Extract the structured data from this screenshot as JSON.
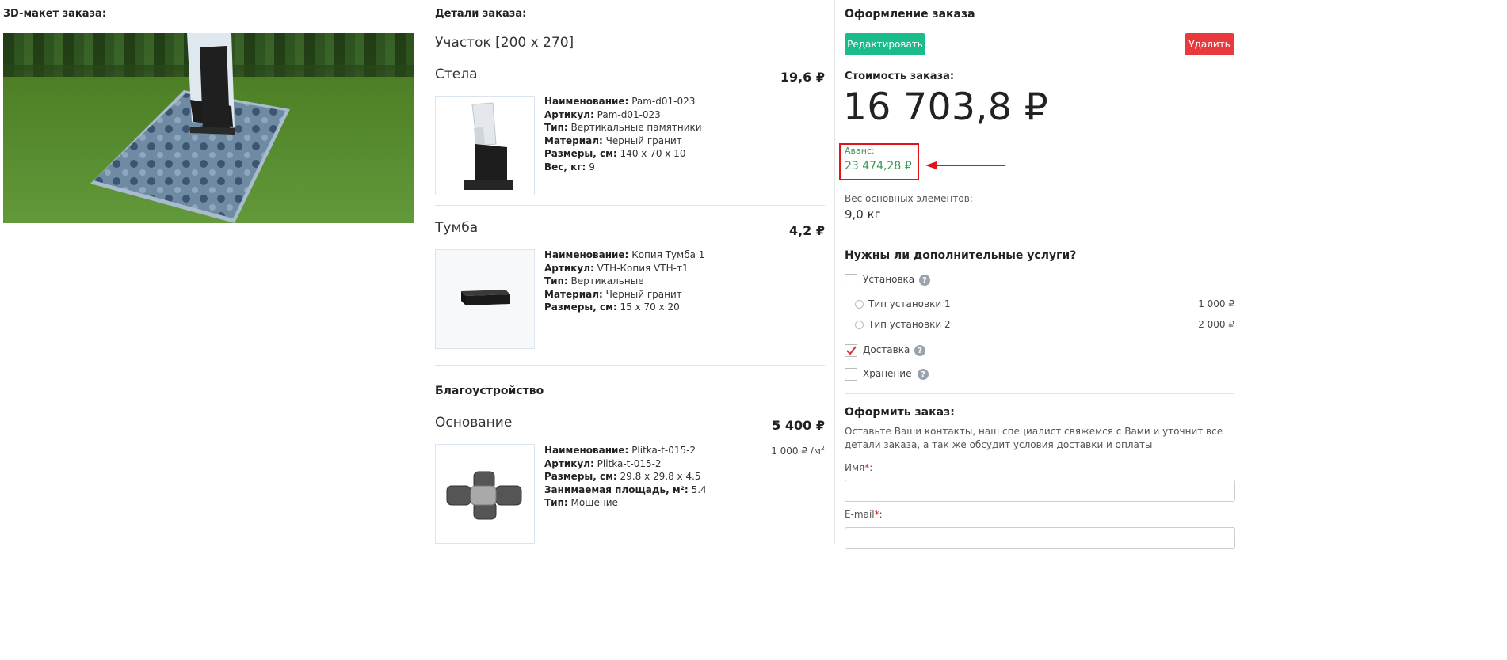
{
  "left": {
    "title": "3D-макет заказа:"
  },
  "middle": {
    "title": "Детали заказа:",
    "plot": "Участок [200 x 270]",
    "items": [
      {
        "name": "Стела",
        "price": "19,6 ₽",
        "specs": [
          {
            "k": "Наименование:",
            "v": "Pam-d01-023"
          },
          {
            "k": "Артикул:",
            "v": "Pam-d01-023"
          },
          {
            "k": "Тип:",
            "v": "Вертикальные памятники"
          },
          {
            "k": "Материал:",
            "v": "Черный гранит"
          },
          {
            "k": "Размеры, см:",
            "v": "140 x 70 x 10"
          },
          {
            "k": "Вес, кг:",
            "v": "9"
          }
        ]
      },
      {
        "name": "Тумба",
        "price": "4,2 ₽",
        "specs": [
          {
            "k": "Наименование:",
            "v": "Копия Тумба 1"
          },
          {
            "k": "Артикул:",
            "v": "VTH-Копия VTH-т1"
          },
          {
            "k": "Тип:",
            "v": "Вертикальные"
          },
          {
            "k": "Материал:",
            "v": "Черный гранит"
          },
          {
            "k": "Размеры, см:",
            "v": "15 x 70 x 20"
          }
        ]
      }
    ],
    "landscaping": {
      "title": "Благоустройство",
      "item": {
        "name": "Основание",
        "price": "5 400 ₽",
        "unit_price": "1 000 ₽ /м",
        "unit_sup": "2",
        "specs": [
          {
            "k": "Наименование:",
            "v": "Plitka-t-015-2"
          },
          {
            "k": "Артикул:",
            "v": "Plitka-t-015-2"
          },
          {
            "k": "Размеры, см:",
            "v": "29.8 x 29.8 x 4.5"
          },
          {
            "k": "Занимаемая площадь, м²:",
            "v": "5.4"
          },
          {
            "k": "Тип:",
            "v": "Мощение"
          }
        ]
      }
    }
  },
  "right": {
    "title": "Оформление заказа",
    "edit_button": "Редактировать",
    "delete_button": "Удалить",
    "cost_label": "Стоимость заказа:",
    "cost_value": "16 703,8 ₽",
    "advance_label": "Аванс:",
    "advance_value": "23 474,28 ₽",
    "weight_label": "Вес основных элементов:",
    "weight_value": "9,0 кг",
    "services_title": "Нужны ли дополнительные услуги?",
    "services": {
      "install": {
        "label": "Установка",
        "checked": false
      },
      "install_type_1": {
        "label": "Тип установки 1",
        "price": "1 000 ₽"
      },
      "install_type_2": {
        "label": "Тип установки 2",
        "price": "2 000 ₽"
      },
      "delivery": {
        "label": "Доставка",
        "checked": true
      },
      "storage": {
        "label": "Хранение",
        "checked": false
      }
    },
    "order_title": "Оформить заказ:",
    "order_text": "Оставьте Ваши контакты, наш специалист свяжемся с Вами и уточнит все детали заказа, а так же обсудит условия доставки и оплаты",
    "name_label": "Имя",
    "email_label": "E-mail",
    "required_mark": "*",
    "colon": ":"
  },
  "colors": {
    "edit": "#1abc8c",
    "delete": "#e8393c",
    "advance": "#3c9a57",
    "annotation": "#e0141b"
  }
}
